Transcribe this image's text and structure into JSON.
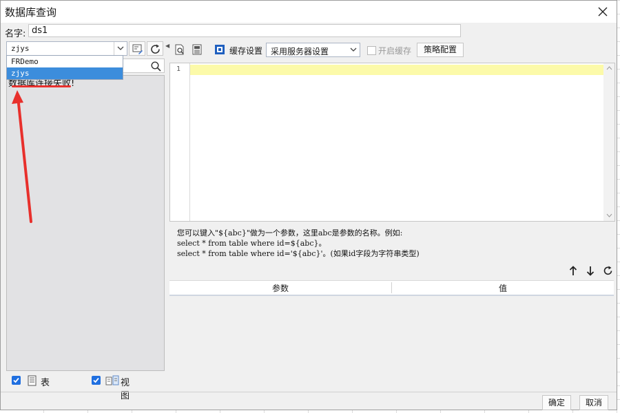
{
  "window": {
    "title": "数据库查询"
  },
  "name_field": {
    "label": "名字:",
    "value": "ds1"
  },
  "datasource": {
    "selected": "zjys",
    "options": [
      "FRDemo",
      "zjys"
    ],
    "status_text": "数据库连接失败!"
  },
  "left_checks": {
    "table_label": "表",
    "view_label": "视图"
  },
  "toolbar": {
    "cache_label": "缓存设置",
    "cache_value": "采用服务器设置",
    "enable_cache_label": "开启缓存",
    "policy_button": "策略配置"
  },
  "editor": {
    "line_number": "1",
    "content": ""
  },
  "hint": {
    "line1": "您可以键入\"${abc}\"做为一个参数，这里abc是参数的名称。例如:",
    "line2": "select * from table where id=${abc}。",
    "line3": "select * from table where id='${abc}'。(如果id字段为字符串类型)"
  },
  "param_table": {
    "columns": [
      "参数",
      "值"
    ]
  },
  "buttons": {
    "ok": "确定",
    "cancel": "取消"
  },
  "colors": {
    "selection": "#3c8ddc",
    "annotation": "#e8302c",
    "active_line": "#fcfaa9"
  }
}
